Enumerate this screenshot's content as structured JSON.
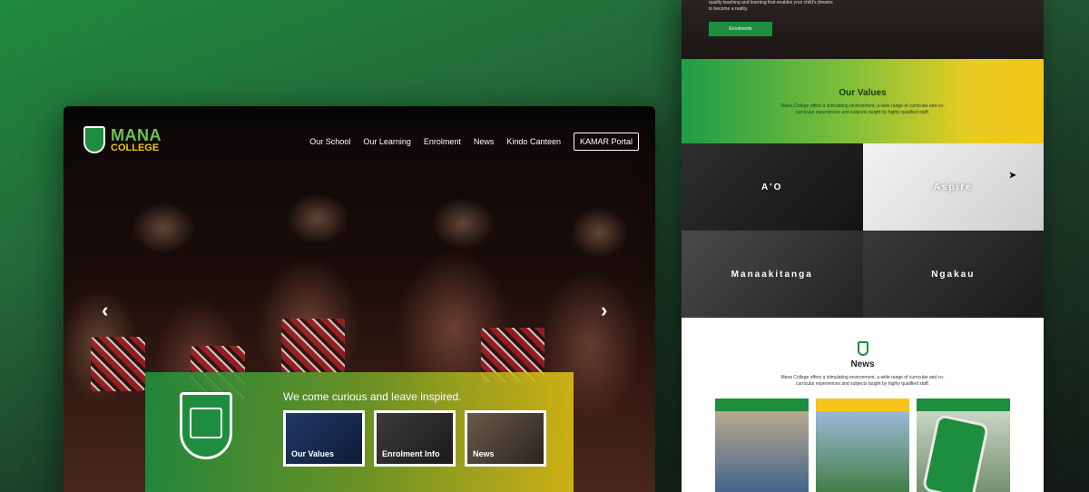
{
  "desktop": {
    "logo": {
      "line1": "MANA",
      "line2": "COLLEGE"
    },
    "nav": [
      "Our School",
      "Our Learning",
      "Enrolment",
      "News",
      "Kindo Canteen"
    ],
    "nav_button": "KAMAR Portal",
    "arrows": {
      "prev": "‹",
      "next": "›"
    },
    "banner": {
      "tagline": "We come curious and leave inspired.",
      "tiles": [
        "Our Values",
        "Enrolment Info",
        "News"
      ]
    }
  },
  "mobile": {
    "hero_text": "quality teaching and learning that enables your child's dreams to become a reality.",
    "enrol_button": "Enrolments",
    "values": {
      "title": "Our Values",
      "desc": "Mana College offers a stimulating environment, a wide range of curricular and co-curricular experiences and subjects taught by highly qualified staff.",
      "items": [
        "A'O",
        "Aspire",
        "Manaakitanga",
        "Ngakau"
      ]
    },
    "news": {
      "title": "News",
      "desc": "Mana College offers a stimulating environment, a wide range of curricular and co-curricular experiences and subjects taught by highly qualified staff."
    }
  },
  "colors": {
    "green": "#1e8e3e",
    "yellow": "#f5c518"
  }
}
